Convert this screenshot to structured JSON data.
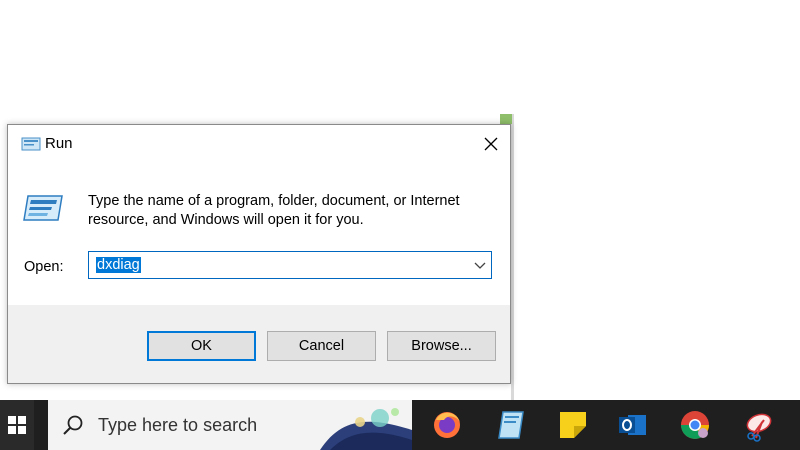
{
  "dialog": {
    "title": "Run",
    "description": "Type the name of a program, folder, document, or Internet resource, and Windows will open it for you.",
    "open_label": "Open:",
    "open_value": "dxdiag",
    "buttons": {
      "ok": "OK",
      "cancel": "Cancel",
      "browse": "Browse..."
    }
  },
  "taskbar": {
    "search_placeholder": "Type here to search",
    "apps": [
      "firefox-icon",
      "notepad-icon",
      "sticky-notes-icon",
      "outlook-icon",
      "chrome-icon",
      "snipping-tool-icon"
    ]
  },
  "colors": {
    "accent": "#0078d7",
    "taskbar": "#1f1f1f",
    "dialog_bg": "#f0f0f0"
  }
}
